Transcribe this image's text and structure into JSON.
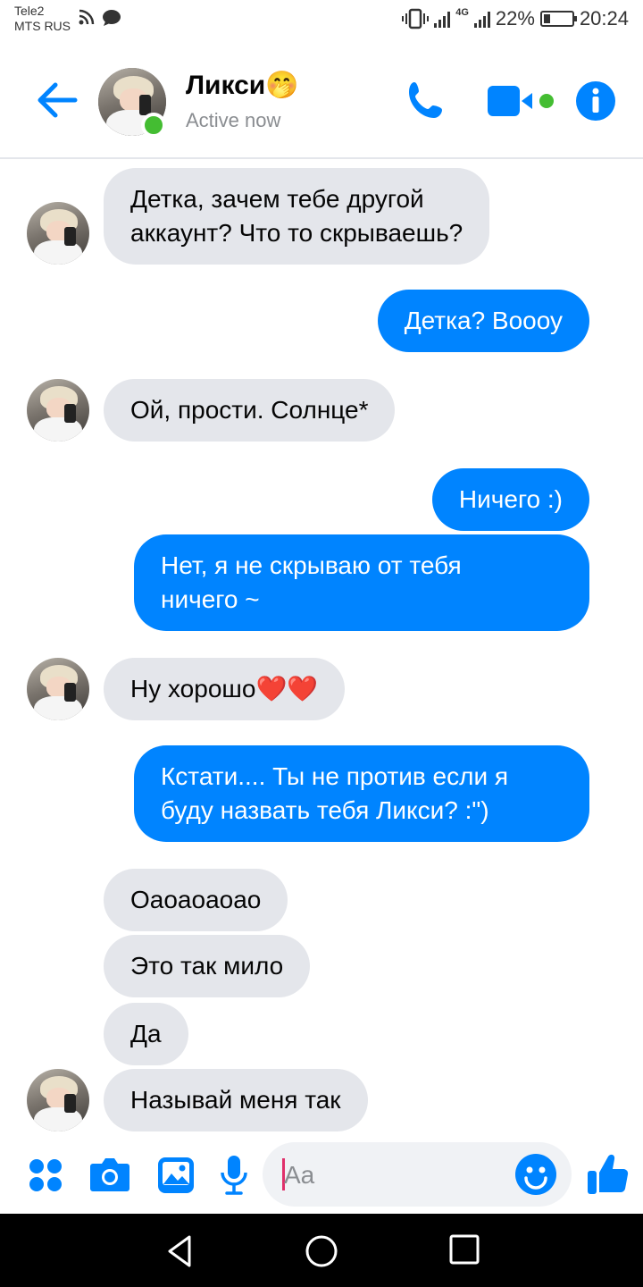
{
  "status_bar": {
    "carrier_line1": "Tele2",
    "carrier_line2": "MTS RUS",
    "network": "4G",
    "battery": "22%",
    "time": "20:24"
  },
  "header": {
    "back_icon": "arrow-left-icon",
    "contact_name": "Ликси🤭",
    "contact_status": "Active now",
    "call_icon": "phone-icon",
    "video_icon": "video-camera-icon",
    "info_icon": "info-icon",
    "accent_color": "#0084ff"
  },
  "messages": [
    {
      "side": "in",
      "text_lines": [
        "Детка, зачем тебе другой",
        "аккаунт? Что то скрываешь?"
      ],
      "avatar": true
    },
    {
      "side": "out",
      "text_lines": [
        "Детка? Воооу"
      ]
    },
    {
      "side": "in",
      "text_lines": [
        "Ой, прости. Солнце*"
      ],
      "avatar": true
    },
    {
      "side": "out",
      "text_lines": [
        "Ничего :)"
      ]
    },
    {
      "side": "out",
      "text_lines": [
        "Нет, я не скрываю от тебя",
        "ничего ~"
      ]
    },
    {
      "side": "in",
      "text_lines": [
        "Ну хорошо❤️❤️"
      ],
      "avatar": true
    },
    {
      "side": "out",
      "text_lines": [
        "Кстати.... Ты не против если я",
        "буду назвать тебя Ликси? :\")"
      ]
    },
    {
      "side": "in",
      "text_lines": [
        "Оаоаоаоао"
      ]
    },
    {
      "side": "in",
      "text_lines": [
        "Это так мило"
      ]
    },
    {
      "side": "in",
      "text_lines": [
        "Да"
      ]
    },
    {
      "side": "in",
      "text_lines": [
        "Называй меня так"
      ],
      "avatar": true
    }
  ],
  "composer": {
    "placeholder": "Aa",
    "icons": [
      "apps-icon",
      "camera-icon",
      "gallery-icon",
      "microphone-icon",
      "emoji-icon",
      "thumbs-up-icon"
    ]
  },
  "colors": {
    "outgoing_bubble": "#0084ff",
    "incoming_bubble": "#e4e6eb",
    "online": "#44bd32"
  }
}
